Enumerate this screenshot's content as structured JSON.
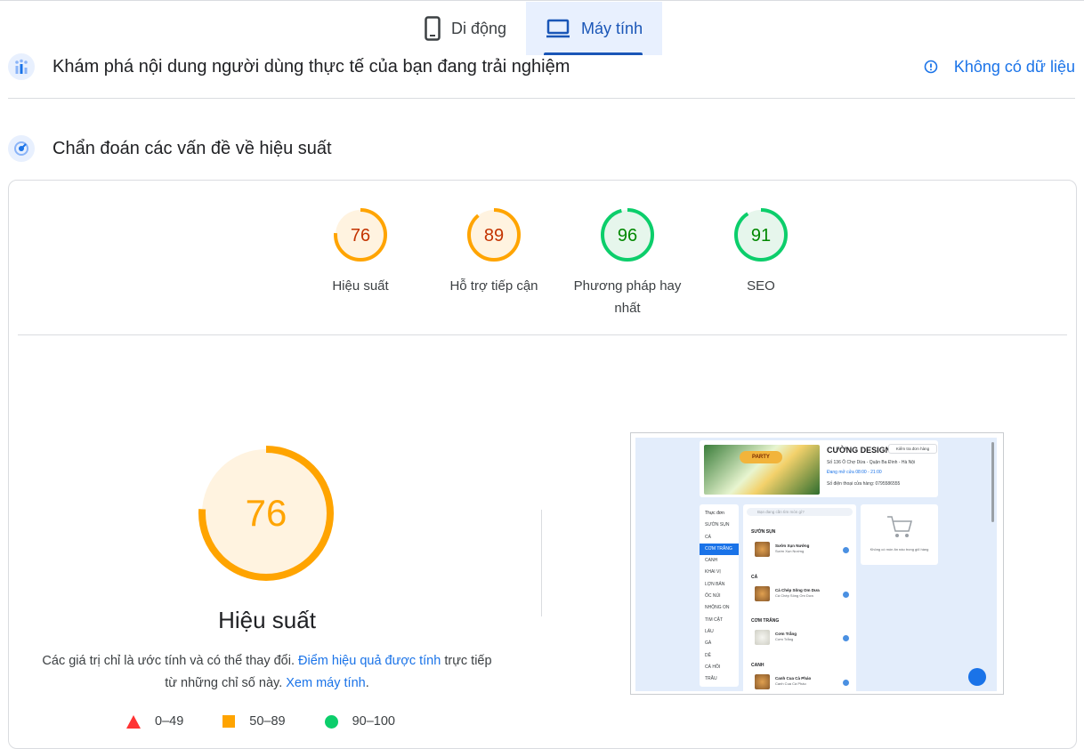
{
  "tabs": [
    {
      "label": "Di động",
      "icon": "phone-icon",
      "active": false
    },
    {
      "label": "Máy tính",
      "icon": "laptop-icon",
      "active": true
    }
  ],
  "field_data": {
    "title": "Khám phá nội dung người dùng thực tế của bạn đang trải nghiệm",
    "status": "Không có dữ liệu"
  },
  "diagnose": {
    "title": "Chẩn đoán các vấn đề về hiệu suất"
  },
  "scores": [
    {
      "value": "76",
      "label": "Hiệu suất",
      "color": "#ffa400",
      "text_color": "#c33300",
      "fill": "#fff3e0"
    },
    {
      "value": "89",
      "label": "Hỗ trợ tiếp cận",
      "color": "#ffa400",
      "text_color": "#c33300",
      "fill": "#fff3e0"
    },
    {
      "value": "96",
      "label": "Phương pháp hay nhất",
      "color": "#0cce6b",
      "text_color": "#008800",
      "fill": "#e6f6ec"
    },
    {
      "value": "91",
      "label": "SEO",
      "color": "#0cce6b",
      "text_color": "#008800",
      "fill": "#e6f6ec"
    }
  ],
  "performance": {
    "score": "76",
    "title": "Hiệu suất",
    "desc_before": "Các giá trị chỉ là ước tính và có thể thay đổi. ",
    "desc_link1": "Điểm hiệu quả được tính",
    "desc_mid": " trực tiếp từ những chỉ số này. ",
    "desc_link2": "Xem máy tính",
    "desc_end": "."
  },
  "legend": [
    {
      "range": "0–49",
      "shape": "triangle",
      "color": "#ff3333"
    },
    {
      "range": "50–89",
      "shape": "square",
      "color": "#ffa400"
    },
    {
      "range": "90–100",
      "shape": "circle",
      "color": "#0cce6b"
    }
  ],
  "thumbnail": {
    "banner_label": "PARTY",
    "shop_name": "CƯỜNG DESIGN",
    "order_check": "Kiểm tra đơn hàng",
    "address": "Số 136 Ô Chợ Dừa - Quận Ba Đình - Hà Nội",
    "hours": "Đang mở cửa 08:00 - 21:00",
    "phone": "Số điện thoại cửa hàng: 0795586555",
    "menu_title": "Thực đơn",
    "menu": [
      "SƯỜN SỤN",
      "CÁ",
      "CƠM TRẮNG",
      "CANH",
      "KHAI VỊ",
      "LỢN BẢN",
      "ỐC NÚI",
      "NHỘNG ON",
      "TIM CẬT",
      "LẨU",
      "GÀ",
      "DÊ",
      "CÁ HỒI",
      "TRÂU"
    ],
    "search_placeholder": "Bạn đang cần tìm món gì?",
    "sections": [
      {
        "name": "SƯỜN SỤN",
        "item": "Sườn Xụn Nướng",
        "sub": "Sườn Xụn Nướng"
      },
      {
        "name": "CÁ",
        "item": "Cá Chép Sông Om Dưa",
        "sub": "Cá Chép Sông Om Dưa"
      },
      {
        "name": "CƠM TRẮNG",
        "item": "Cơm Trắng",
        "sub": "Cơm Trắng"
      },
      {
        "name": "CANH",
        "item": "Canh Cua Cà Pháo",
        "sub": "Canh Cua Cà Pháo"
      }
    ],
    "cart_empty": "Không có món ăn nào trong giỏ hàng"
  }
}
